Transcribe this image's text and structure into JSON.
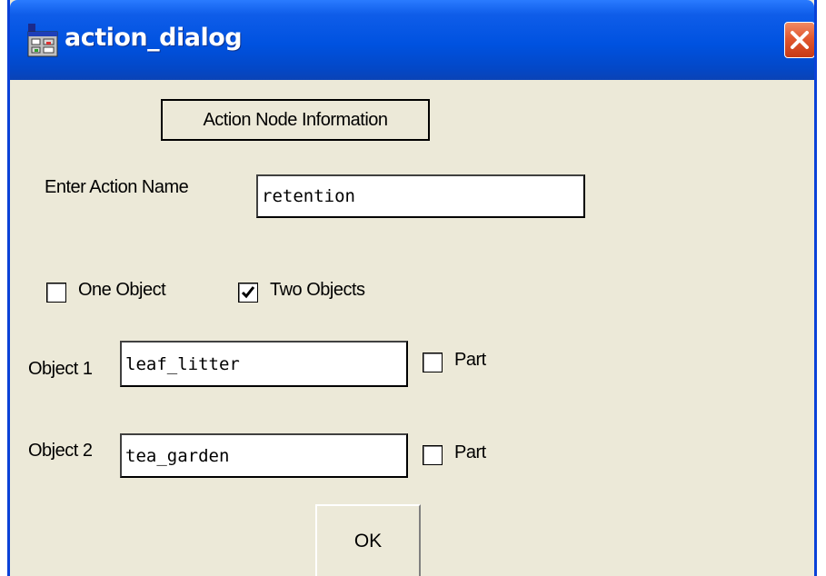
{
  "window": {
    "title": "action_dialog",
    "icon": "app-icon",
    "close_icon": "close-icon"
  },
  "dialog": {
    "group_label": "Action Node Information",
    "action_name_label": "Enter Action Name",
    "action_name_value": "retention",
    "one_object_label": "One Object",
    "one_object_checked": false,
    "two_objects_label": "Two Objects",
    "two_objects_checked": true,
    "object1_label": "Object 1",
    "object1_value": "leaf_litter",
    "object1_part_label": "Part",
    "object1_part_checked": false,
    "object2_label": "Object 2",
    "object2_value": "tea_garden",
    "object2_part_label": "Part",
    "object2_part_checked": false,
    "ok_label": "OK"
  },
  "colors": {
    "titlebar_blue": "#0052e0",
    "window_face": "#ece9d8",
    "close_red": "#e2582f"
  }
}
